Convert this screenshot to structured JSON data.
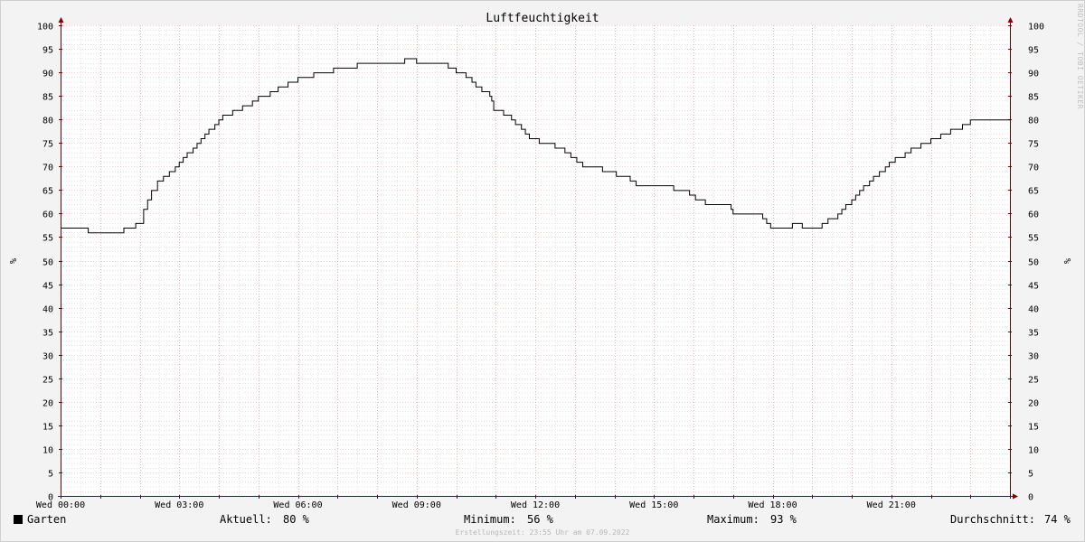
{
  "chart_data": {
    "type": "line",
    "title": "Luftfeuchtigkeit",
    "ylabel": "%",
    "ylim": [
      0,
      100
    ],
    "yticks": [
      0,
      5,
      10,
      15,
      20,
      25,
      30,
      35,
      40,
      45,
      50,
      55,
      60,
      65,
      70,
      75,
      80,
      85,
      90,
      95,
      100
    ],
    "xlim": [
      0,
      24
    ],
    "xtick_positions": [
      0,
      3,
      6,
      9,
      12,
      15,
      18,
      21
    ],
    "xtick_labels": [
      "Wed 00:00",
      "Wed 03:00",
      "Wed 06:00",
      "Wed 09:00",
      "Wed 12:00",
      "Wed 15:00",
      "Wed 18:00",
      "Wed 21:00"
    ],
    "grid": true,
    "series": [
      {
        "name": "Garten",
        "color": "#000000",
        "step": true,
        "points": [
          [
            0.0,
            57
          ],
          [
            0.7,
            56
          ],
          [
            1.6,
            57
          ],
          [
            1.9,
            58
          ],
          [
            2.1,
            61
          ],
          [
            2.2,
            63
          ],
          [
            2.3,
            65
          ],
          [
            2.45,
            67
          ],
          [
            2.6,
            68
          ],
          [
            2.75,
            69
          ],
          [
            2.9,
            70
          ],
          [
            3.0,
            71
          ],
          [
            3.1,
            72
          ],
          [
            3.2,
            73
          ],
          [
            3.35,
            74
          ],
          [
            3.45,
            75
          ],
          [
            3.55,
            76
          ],
          [
            3.65,
            77
          ],
          [
            3.75,
            78
          ],
          [
            3.9,
            79
          ],
          [
            4.0,
            80
          ],
          [
            4.1,
            81
          ],
          [
            4.35,
            82
          ],
          [
            4.6,
            83
          ],
          [
            4.85,
            84
          ],
          [
            5.0,
            85
          ],
          [
            5.3,
            86
          ],
          [
            5.5,
            87
          ],
          [
            5.75,
            88
          ],
          [
            6.0,
            89
          ],
          [
            6.4,
            90
          ],
          [
            6.9,
            91
          ],
          [
            7.5,
            92
          ],
          [
            8.7,
            93
          ],
          [
            9.0,
            92
          ],
          [
            9.8,
            91
          ],
          [
            10.0,
            90
          ],
          [
            10.25,
            89
          ],
          [
            10.4,
            88
          ],
          [
            10.5,
            87
          ],
          [
            10.65,
            86
          ],
          [
            10.85,
            85
          ],
          [
            10.9,
            84
          ],
          [
            10.95,
            82
          ],
          [
            11.2,
            81
          ],
          [
            11.4,
            80
          ],
          [
            11.5,
            79
          ],
          [
            11.65,
            78
          ],
          [
            11.75,
            77
          ],
          [
            11.85,
            76
          ],
          [
            12.1,
            75
          ],
          [
            12.5,
            74
          ],
          [
            12.75,
            73
          ],
          [
            12.9,
            72
          ],
          [
            13.05,
            71
          ],
          [
            13.2,
            70
          ],
          [
            13.7,
            69
          ],
          [
            14.05,
            68
          ],
          [
            14.4,
            67
          ],
          [
            14.55,
            66
          ],
          [
            15.5,
            65
          ],
          [
            15.9,
            64
          ],
          [
            16.05,
            63
          ],
          [
            16.3,
            62
          ],
          [
            16.95,
            61
          ],
          [
            17.0,
            60
          ],
          [
            17.75,
            59
          ],
          [
            17.85,
            58
          ],
          [
            17.95,
            57
          ],
          [
            18.5,
            58
          ],
          [
            18.75,
            57
          ],
          [
            19.25,
            58
          ],
          [
            19.4,
            59
          ],
          [
            19.65,
            60
          ],
          [
            19.75,
            61
          ],
          [
            19.85,
            62
          ],
          [
            20.0,
            63
          ],
          [
            20.1,
            64
          ],
          [
            20.2,
            65
          ],
          [
            20.3,
            66
          ],
          [
            20.45,
            67
          ],
          [
            20.55,
            68
          ],
          [
            20.7,
            69
          ],
          [
            20.85,
            70
          ],
          [
            20.95,
            71
          ],
          [
            21.1,
            72
          ],
          [
            21.35,
            73
          ],
          [
            21.5,
            74
          ],
          [
            21.75,
            75
          ],
          [
            22.0,
            76
          ],
          [
            22.25,
            77
          ],
          [
            22.5,
            78
          ],
          [
            22.8,
            79
          ],
          [
            23.0,
            80
          ],
          [
            24.0,
            80
          ]
        ]
      }
    ],
    "legend": {
      "name": "Garten",
      "current_label": "Aktuell:",
      "current_value": "80 %",
      "min_label": "Minimum:",
      "min_value": "56 %",
      "max_label": "Maximum:",
      "max_value": "93 %",
      "avg_label": "Durchschnitt:",
      "avg_value": "74 %"
    },
    "footer": "Erstellungszeit: 23:55 Uhr am 07.09.2022",
    "watermark": "RRDTOOL / TOBI OETIKER",
    "colors": {
      "background": "#f3f3f3",
      "plot_background": "#ffffff",
      "major_grid": "#e8a0a0",
      "minor_grid": "#c8c8c8",
      "axis": "#800000",
      "line": "#000000"
    }
  }
}
